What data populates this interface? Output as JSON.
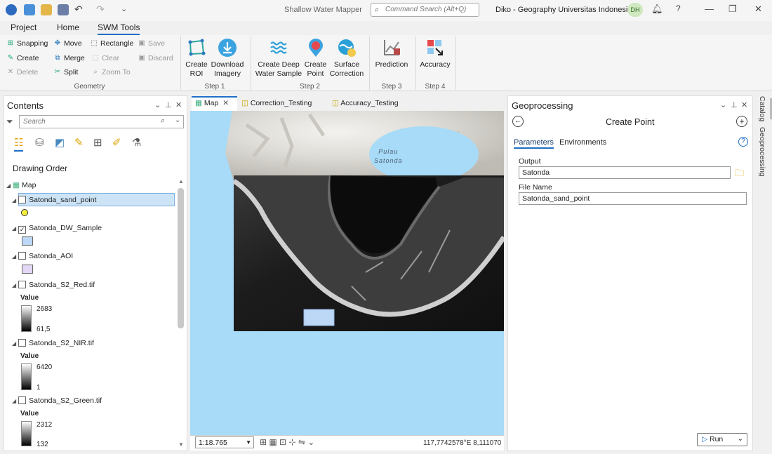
{
  "title_bar": {
    "app_title": "Shallow Water Mapper",
    "command_search_placeholder": "Command Search (Alt+Q)",
    "user": "Diko - Geography Universitas Indonesia",
    "avatar_initials": "DH",
    "help": "?"
  },
  "ribbon": {
    "tabs": [
      "Project",
      "Home",
      "SWM Tools"
    ],
    "active_tab": "SWM Tools",
    "geometry": {
      "items": [
        "Snapping",
        "Move",
        "Rectangle",
        "Save",
        "Create",
        "Merge",
        "Clear",
        "Discard",
        "Delete",
        "Split",
        "Zoom To"
      ],
      "group_label": "Geometry"
    },
    "step1": {
      "buttons": [
        "Create\nROI",
        "Download\nImagery"
      ],
      "group_label": "Step 1"
    },
    "step2": {
      "buttons": [
        "Create Deep\nWater Sample",
        "Create\nPoint",
        "Surface\nCorrection"
      ],
      "group_label": "Step 2"
    },
    "step3": {
      "buttons": [
        "Prediction"
      ],
      "group_label": "Step 3"
    },
    "step4": {
      "buttons": [
        "Accuracy"
      ],
      "group_label": "Step 4"
    }
  },
  "contents": {
    "title": "Contents",
    "search_placeholder": "Search",
    "drawing_order": "Drawing Order",
    "map_label": "Map",
    "layers": [
      {
        "name": "Satonda_sand_point",
        "checked": false,
        "selected": true
      },
      {
        "name": "Satonda_DW_Sample",
        "checked": true
      },
      {
        "name": "Satonda_AOI",
        "checked": false
      },
      {
        "name": "Satonda_S2_Red.tif",
        "checked": false,
        "value_label": "Value",
        "max": "2683",
        "min": "61,5"
      },
      {
        "name": "Satonda_S2_NIR.tif",
        "checked": false,
        "value_label": "Value",
        "max": "6420",
        "min": "1"
      },
      {
        "name": "Satonda_S2_Green.tif",
        "checked": false,
        "value_label": "Value",
        "max": "2312",
        "min": "132"
      }
    ]
  },
  "map": {
    "tabs": [
      "Map",
      "Correction_Testing",
      "Accuracy_Testing"
    ],
    "island_label": "Pulau\nSatonda",
    "scale": "1:18.765",
    "coordinates": "117,7742578°E 8,111070"
  },
  "geoprocessing": {
    "title": "Geoprocessing",
    "tool_name": "Create Point",
    "tabs": [
      "Parameters",
      "Environments"
    ],
    "fields": [
      {
        "label": "Output",
        "value": "Satonda"
      },
      {
        "label": "File Name",
        "value": "Satonda_sand_point"
      }
    ],
    "run_label": "Run"
  },
  "side_tabs": [
    "Catalog",
    "Geoprocessing"
  ],
  "colors": {
    "accent": "#1f6fc6",
    "water": "#a7dbf7",
    "selection": "#cde4f7"
  }
}
